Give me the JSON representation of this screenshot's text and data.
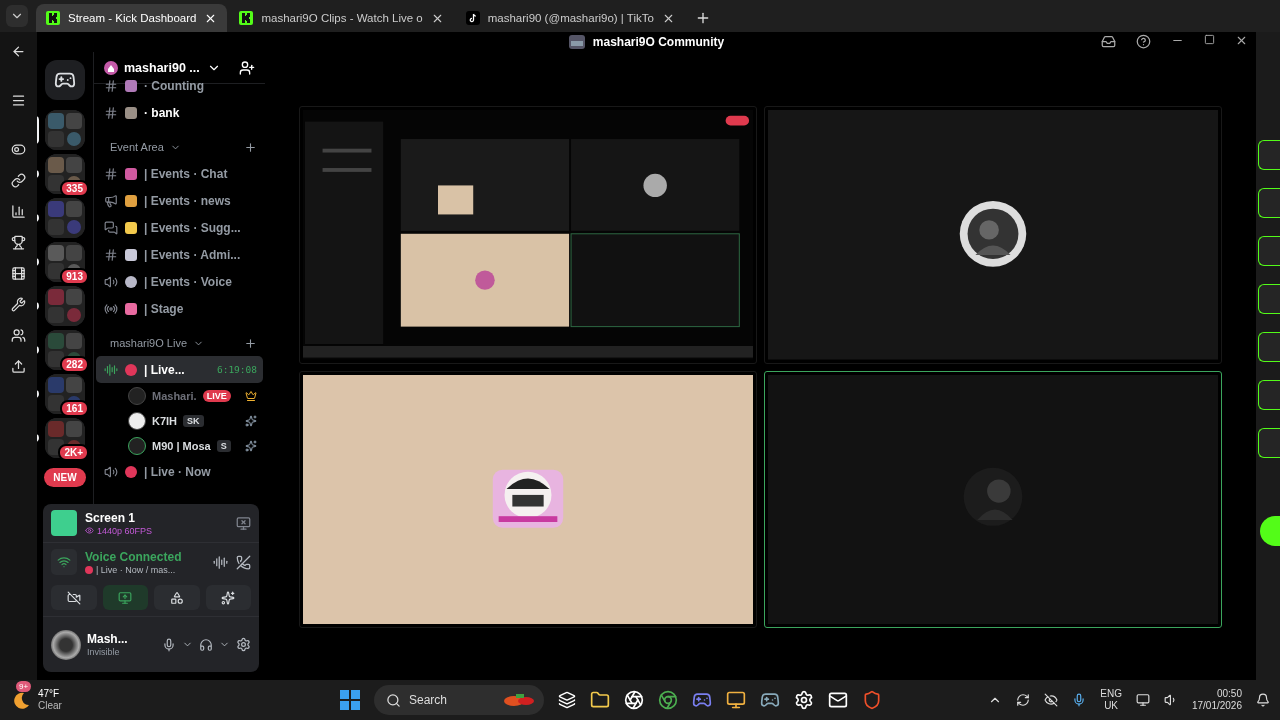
{
  "browser_tabs": [
    {
      "title": "Stream - Kick Dashboard",
      "kind": "kick",
      "selected": true
    },
    {
      "title": "mashari9O Clips - Watch Live o",
      "kind": "kick",
      "selected": false
    },
    {
      "title": "mashari90 (@mashari9o) | TikTo",
      "kind": "tiktok",
      "selected": false
    }
  ],
  "window": {
    "title": "mashari9O Community"
  },
  "server": {
    "name": "mashari90 ..."
  },
  "servers": [
    {
      "selected": true
    },
    {
      "selected": false,
      "badge": "335"
    },
    {
      "selected": false
    },
    {
      "selected": false,
      "badge": "913"
    },
    {
      "selected": false
    },
    {
      "selected": false,
      "badge": "282"
    },
    {
      "selected": false,
      "badge": "161"
    },
    {
      "selected": false,
      "badge": "2K+"
    }
  ],
  "new_badge": "NEW",
  "channels": [
    {
      "kind": "text",
      "name": "· Counting",
      "color": "#b07ab8",
      "unread": false,
      "selected": false
    },
    {
      "kind": "text",
      "name": "· bank",
      "color": "#9a8f86",
      "unread": true,
      "selected": false
    },
    {
      "kind": "category",
      "name": "Event Area"
    },
    {
      "kind": "text",
      "name": "| Events · Chat",
      "color": "#d05aa0",
      "unread": false,
      "selected": false
    },
    {
      "kind": "announcement",
      "name": "| Events · news",
      "color": "#e0a040",
      "unread": false,
      "selected": false
    },
    {
      "kind": "forum",
      "name": "| Events · Sugg...",
      "color": "#f2c94c",
      "unread": false,
      "selected": false
    },
    {
      "kind": "text",
      "name": "| Events · Admi...",
      "color": "#c8c8d8",
      "unread": false,
      "selected": false
    },
    {
      "kind": "voice",
      "name": "| Events · Voice",
      "color": "#b8b8c8",
      "unread": false,
      "selected": false
    },
    {
      "kind": "stage",
      "name": "| Stage",
      "color": "#e86aa0",
      "unread": false,
      "selected": false
    },
    {
      "kind": "category",
      "name": "mashari9O Live"
    },
    {
      "kind": "voice",
      "name": "| Live...",
      "color": "#e0365a",
      "unread": true,
      "selected": true,
      "timer": "6:19:08",
      "members": [
        {
          "name": "Mashari.",
          "dimmed": true,
          "badge": "LIVE"
        },
        {
          "name": "K7IH",
          "dimmed": false,
          "tag": "SK"
        },
        {
          "name": "M90 | Mosa",
          "dimmed": false,
          "tag": "S"
        }
      ]
    },
    {
      "kind": "voice",
      "name": "| Live · Now",
      "color": "#e0365a",
      "unread": false,
      "selected": false
    }
  ],
  "stream": {
    "title": "Screen 1",
    "quality": "1440p 60FPS"
  },
  "voice": {
    "status": "Voice Connected",
    "channel": "| Live · Now / mas..."
  },
  "controls": [
    {
      "kind": "camera",
      "active": false
    },
    {
      "kind": "screen",
      "active": true
    },
    {
      "kind": "activities",
      "active": false
    },
    {
      "kind": "soundboard",
      "active": false
    }
  ],
  "user": {
    "name": "Mash...",
    "status": "Invisible"
  },
  "tiles": [
    {
      "kind": "screen",
      "speaking": false
    },
    {
      "kind": "avatar-light",
      "speaking": false
    },
    {
      "kind": "avatar-beige",
      "speaking": false
    },
    {
      "kind": "avatar-dark",
      "speaking": true
    }
  ],
  "taskbar": {
    "weather_badge": "9+",
    "temperature": "47°F",
    "condition": "Clear",
    "search_placeholder": "Search",
    "language": "ENG",
    "region": "UK",
    "time": "00:50",
    "date": "17/01/2026"
  }
}
